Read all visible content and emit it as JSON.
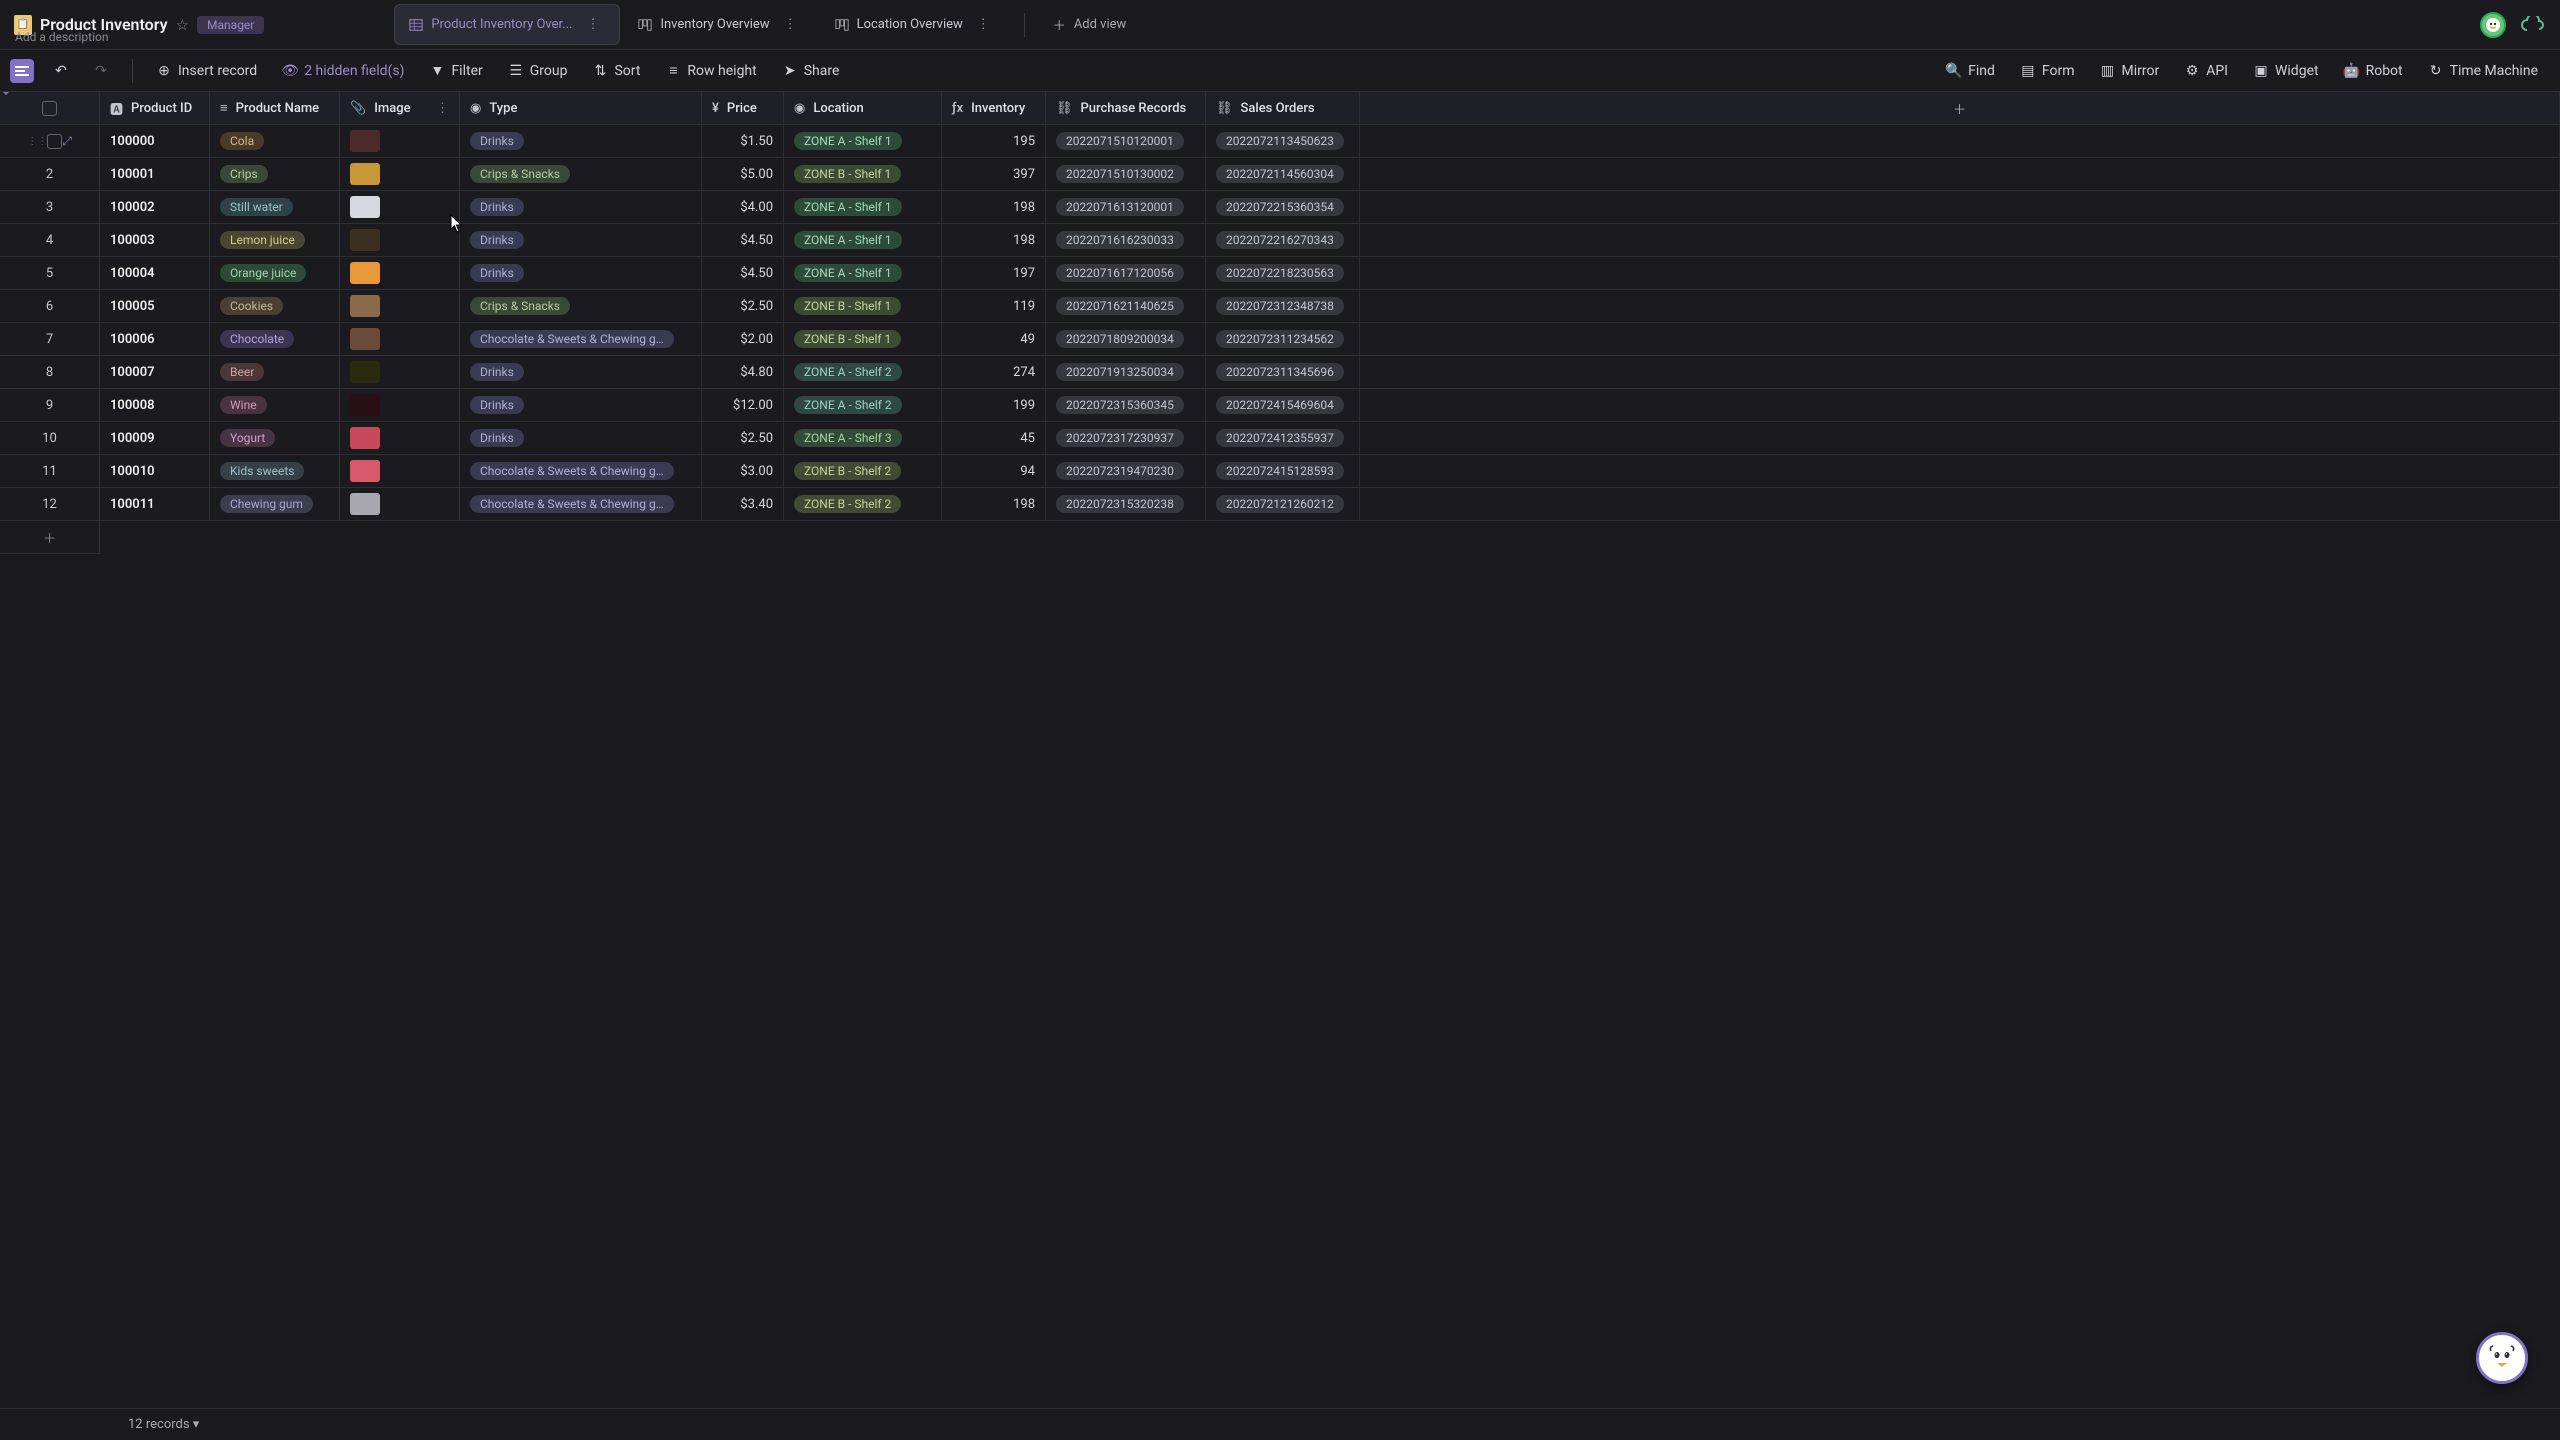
{
  "header": {
    "title": "Product Inventory",
    "description_placeholder": "Add a description",
    "badge": "Manager"
  },
  "tabs": [
    {
      "label": "Product Inventory Over...",
      "active": true
    },
    {
      "label": "Inventory Overview",
      "active": false
    },
    {
      "label": "Location Overview",
      "active": false
    }
  ],
  "add_view": "Add view",
  "toolbar": {
    "insert": "Insert record",
    "hidden": "2 hidden field(s)",
    "filter": "Filter",
    "group": "Group",
    "sort": "Sort",
    "rowheight": "Row height",
    "share": "Share",
    "find": "Find",
    "form": "Form",
    "mirror": "Mirror",
    "api": "API",
    "widget": "Widget",
    "robot": "Robot",
    "timemachine": "Time Machine"
  },
  "columns": [
    "Product ID",
    "Product Name",
    "Image",
    "Type",
    "Price",
    "Location",
    "Inventory",
    "Purchase Records",
    "Sales Orders"
  ],
  "rows": [
    {
      "n": "",
      "id": "100000",
      "name": "Cola",
      "ncls": "cola",
      "img": "#4a2a2a",
      "type": "Drinks",
      "tcls": "drinks",
      "price": "$1.50",
      "loc": "ZONE A - Shelf 1",
      "lcls": "zoneA1",
      "inv": "195",
      "pr": "2022071510120001",
      "so": "2022072113450623",
      "hov": true
    },
    {
      "n": "2",
      "id": "100001",
      "name": "Crips",
      "ncls": "crips",
      "img": "#c89838",
      "type": "Crips & Snacks",
      "tcls": "snacks",
      "price": "$5.00",
      "loc": "ZONE B - Shelf 1",
      "lcls": "zoneB1",
      "inv": "397",
      "pr": "2022071510130002",
      "so": "2022072114560304"
    },
    {
      "n": "3",
      "id": "100002",
      "name": "Still water",
      "ncls": "still",
      "img": "#d8d8e0",
      "type": "Drinks",
      "tcls": "drinks",
      "price": "$4.00",
      "loc": "ZONE A - Shelf 1",
      "lcls": "zoneA1",
      "inv": "198",
      "pr": "2022071613120001",
      "so": "2022072215360354"
    },
    {
      "n": "4",
      "id": "100003",
      "name": "Lemon juice",
      "ncls": "lemon",
      "img": "#3a3020",
      "type": "Drinks",
      "tcls": "drinks",
      "price": "$4.50",
      "loc": "ZONE A - Shelf 1",
      "lcls": "zoneA1",
      "inv": "198",
      "pr": "2022071616230033",
      "so": "2022072216270343"
    },
    {
      "n": "5",
      "id": "100004",
      "name": "Orange juice",
      "ncls": "orange",
      "img": "#e89838",
      "type": "Drinks",
      "tcls": "drinks",
      "price": "$4.50",
      "loc": "ZONE A - Shelf 1",
      "lcls": "zoneA1",
      "inv": "197",
      "pr": "2022071617120056",
      "so": "2022072218230563"
    },
    {
      "n": "6",
      "id": "100005",
      "name": "Cookies",
      "ncls": "cookies",
      "img": "#8a6a4a",
      "type": "Crips & Snacks",
      "tcls": "snacks",
      "price": "$2.50",
      "loc": "ZONE B - Shelf 1",
      "lcls": "zoneB1",
      "inv": "119",
      "pr": "2022071621140625",
      "so": "2022072312348738"
    },
    {
      "n": "7",
      "id": "100006",
      "name": "Chocolate",
      "ncls": "choco",
      "img": "#6a4a38",
      "type": "Chocolate & Sweets & Chewing g…",
      "tcls": "chocolate",
      "price": "$2.00",
      "loc": "ZONE B - Shelf 1",
      "lcls": "zoneB1",
      "inv": "49",
      "pr": "2022071809200034",
      "so": "2022072311234562"
    },
    {
      "n": "8",
      "id": "100007",
      "name": "Beer",
      "ncls": "beer",
      "img": "#2a2a10",
      "type": "Drinks",
      "tcls": "drinks",
      "price": "$4.80",
      "loc": "ZONE A - Shelf 2",
      "lcls": "zoneA2",
      "inv": "274",
      "pr": "2022071913250034",
      "so": "2022072311345696"
    },
    {
      "n": "9",
      "id": "100008",
      "name": "Wine",
      "ncls": "wine",
      "img": "#2a1015",
      "type": "Drinks",
      "tcls": "drinks",
      "price": "$12.00",
      "loc": "ZONE A - Shelf 2",
      "lcls": "zoneA2",
      "inv": "199",
      "pr": "2022072315360345",
      "so": "2022072415469604"
    },
    {
      "n": "10",
      "id": "100009",
      "name": "Yogurt",
      "ncls": "yogurt",
      "img": "#c84a5a",
      "type": "Drinks",
      "tcls": "drinks",
      "price": "$2.50",
      "loc": "ZONE A - Shelf 3",
      "lcls": "zoneA3",
      "inv": "45",
      "pr": "2022072317230937",
      "so": "2022072412355937"
    },
    {
      "n": "11",
      "id": "100010",
      "name": "Kids sweets",
      "ncls": "kids",
      "img": "#d85a6a",
      "type": "Chocolate & Sweets & Chewing g…",
      "tcls": "chocolate",
      "price": "$3.00",
      "loc": "ZONE B - Shelf 2",
      "lcls": "zoneB2",
      "inv": "94",
      "pr": "2022072319470230",
      "so": "2022072415128593"
    },
    {
      "n": "12",
      "id": "100011",
      "name": "Chewing gum",
      "ncls": "gum",
      "img": "#a8a8b0",
      "type": "Chocolate & Sweets & Chewing g…",
      "tcls": "chocolate",
      "price": "$3.40",
      "loc": "ZONE B - Shelf 2",
      "lcls": "zoneB2",
      "inv": "198",
      "pr": "2022072315320238",
      "so": "2022072121260212"
    }
  ],
  "footer": {
    "count": "12 records ▾"
  }
}
